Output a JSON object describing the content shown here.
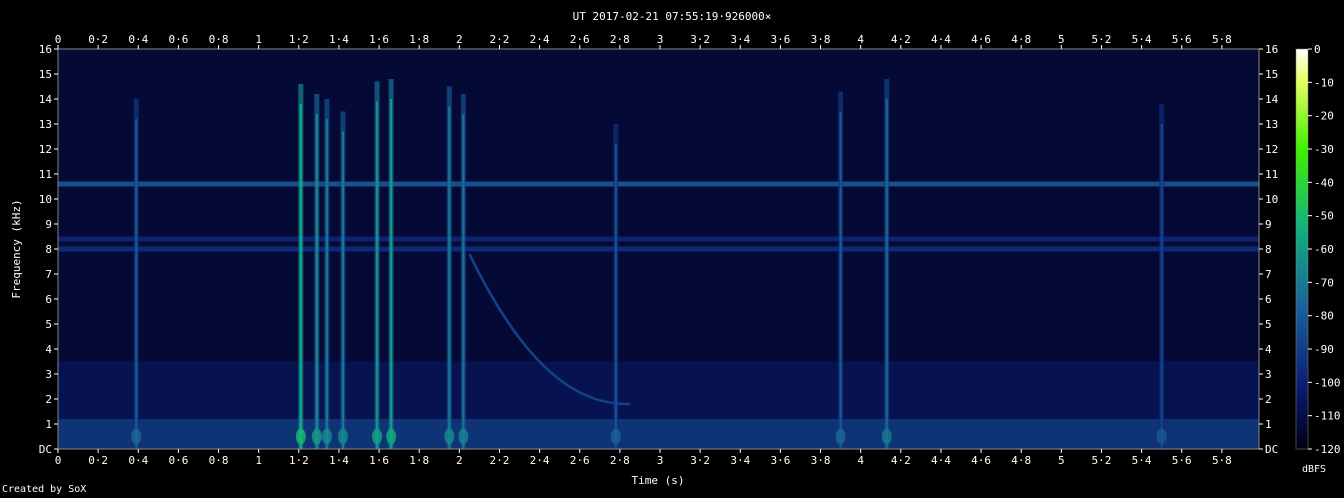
{
  "chart_data": {
    "type": "heatmap",
    "title": "UT 2017-02-21 07:55:19·926000×",
    "xlabel": "Time (s)",
    "ylabel": "Frequency (kHz)",
    "xlim": [
      0,
      5.985
    ],
    "ylim": [
      0,
      16
    ],
    "x_ticks": [
      "0",
      "0·2",
      "0·4",
      "0·6",
      "0·8",
      "1",
      "1·2",
      "1·4",
      "1·6",
      "1·8",
      "2",
      "2·2",
      "2·4",
      "2·6",
      "2·8",
      "3",
      "3·2",
      "3·4",
      "3·6",
      "3·8",
      "4",
      "4·2",
      "4·4",
      "4·6",
      "4·8",
      "5",
      "5·2",
      "5·4",
      "5·6",
      "5·8"
    ],
    "y_ticks": [
      "DC",
      "1",
      "2",
      "3",
      "4",
      "5",
      "6",
      "7",
      "8",
      "9",
      "10",
      "11",
      "12",
      "13",
      "14",
      "15",
      "16"
    ],
    "colorbar": {
      "label": "dBFS",
      "ticks": [
        "0",
        "-10",
        "-20",
        "-30",
        "-40",
        "-50",
        "-60",
        "-70",
        "-80",
        "-90",
        "-100",
        "-110",
        "-120"
      ],
      "range": [
        -120,
        0
      ]
    },
    "features": {
      "noise_floor_dbfs": -105,
      "tones": [
        {
          "freq_khz": 10.6,
          "level_dbfs": -80
        },
        {
          "freq_khz": 8.0,
          "level_dbfs": -95
        },
        {
          "freq_khz": 8.4,
          "level_dbfs": -98
        }
      ],
      "bursts": [
        {
          "t": 0.39,
          "fmax_khz": 14.0,
          "level_dbfs": -80
        },
        {
          "t": 1.21,
          "fmax_khz": 14.6,
          "level_dbfs": -55
        },
        {
          "t": 1.29,
          "fmax_khz": 14.2,
          "level_dbfs": -65
        },
        {
          "t": 1.34,
          "fmax_khz": 14.0,
          "level_dbfs": -70
        },
        {
          "t": 1.42,
          "fmax_khz": 13.5,
          "level_dbfs": -70
        },
        {
          "t": 1.59,
          "fmax_khz": 14.7,
          "level_dbfs": -62
        },
        {
          "t": 1.66,
          "fmax_khz": 14.8,
          "level_dbfs": -60
        },
        {
          "t": 1.95,
          "fmax_khz": 14.5,
          "level_dbfs": -70
        },
        {
          "t": 2.02,
          "fmax_khz": 14.2,
          "level_dbfs": -72
        },
        {
          "t": 2.78,
          "fmax_khz": 13.0,
          "level_dbfs": -82
        },
        {
          "t": 3.9,
          "fmax_khz": 14.3,
          "level_dbfs": -80
        },
        {
          "t": 4.13,
          "fmax_khz": 14.8,
          "level_dbfs": -75
        },
        {
          "t": 5.5,
          "fmax_khz": 13.8,
          "level_dbfs": -85
        }
      ],
      "sweep": {
        "t_start": 2.05,
        "f_start_khz": 7.8,
        "t_end": 2.85,
        "f_end_khz": 1.8
      }
    }
  },
  "footer": "Created by SoX"
}
